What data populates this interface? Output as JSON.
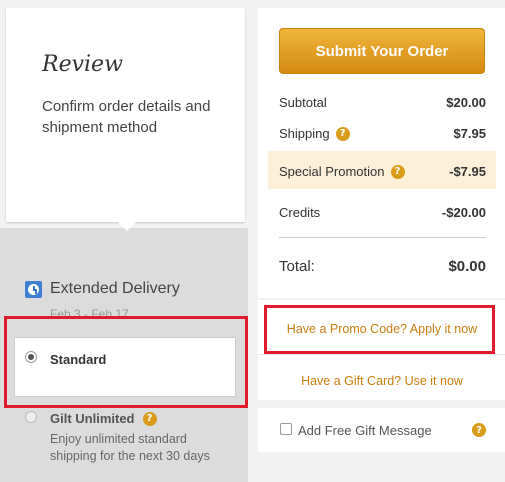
{
  "review": {
    "title": "Review",
    "description": "Confirm order details and shipment method"
  },
  "delivery": {
    "title": "Extended Delivery",
    "dates": "Feb 3 - Feb 17",
    "options": [
      {
        "label": "Standard",
        "selected": true
      },
      {
        "label": "Gilt Unlimited",
        "selected": false,
        "description": "Enjoy unlimited standard shipping for the next 30 days"
      }
    ]
  },
  "summary": {
    "submit_label": "Submit Your Order",
    "subtotal_label": "Subtotal",
    "subtotal_value": "$20.00",
    "shipping_label": "Shipping",
    "shipping_value": "$7.95",
    "promotion_label": "Special Promotion",
    "promotion_value": "-$7.95",
    "credits_label": "Credits",
    "credits_value": "-$20.00",
    "total_label": "Total:",
    "total_value": "$0.00"
  },
  "links": {
    "promo_code": "Have a Promo Code? Apply it now",
    "gift_card": "Have a Gift Card? Use it now"
  },
  "gift_message": {
    "label": "Add Free Gift Message",
    "checked": false
  },
  "icons": {
    "help": "?",
    "help_color": "#d89b1a",
    "clock_color": "#3e7fd1"
  },
  "colors": {
    "accent": "#d89b1a",
    "link": "#c97d10",
    "highlight": "#e21b2b"
  }
}
